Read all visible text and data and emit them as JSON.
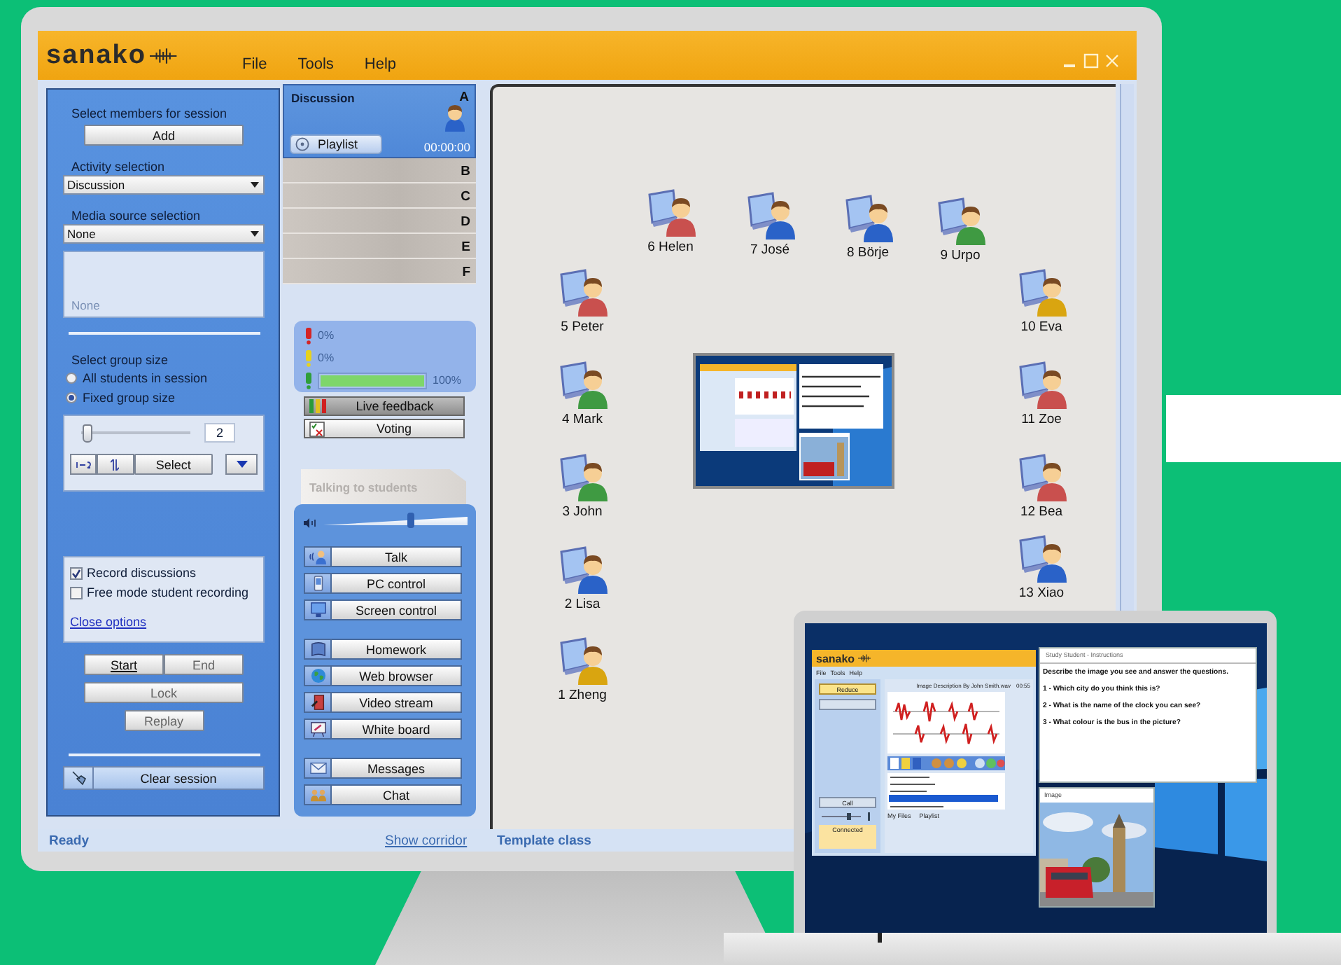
{
  "window": {
    "logo": "sanako",
    "menu": [
      {
        "label": "File"
      },
      {
        "label": "Tools"
      },
      {
        "label": "Help"
      }
    ]
  },
  "members": {
    "label": "Select members for session",
    "button": "Add"
  },
  "activity": {
    "label": "Activity selection",
    "value": "Discussion"
  },
  "media": {
    "label": "Media source selection",
    "value": "None",
    "preview": "None"
  },
  "group_size": {
    "label": "Select group size",
    "options": [
      {
        "label": "All students in session",
        "selected": false
      },
      {
        "label": "Fixed group size",
        "selected": true
      }
    ],
    "slider": {
      "level": 0
    },
    "count": "2",
    "select_button": "Select"
  },
  "options": {
    "checks": [
      {
        "label": "Record discussions",
        "checked": true
      },
      {
        "label": "Free mode student recording",
        "checked": false
      }
    ],
    "link": "Close options"
  },
  "session_buttons": [
    {
      "label": "Start",
      "disabled": false
    },
    {
      "label": "End",
      "disabled": true
    },
    {
      "label": "Lock",
      "disabled": true
    },
    {
      "label": "Replay",
      "disabled": true
    }
  ],
  "clear_button": "Clear session",
  "groups": [
    {
      "letter": "A",
      "selected": true,
      "title": "Discussion",
      "playlist": "Playlist",
      "time": "00:00:00"
    },
    {
      "letter": "B",
      "selected": false
    },
    {
      "letter": "C",
      "selected": false
    },
    {
      "letter": "D",
      "selected": false
    },
    {
      "letter": "E",
      "selected": false
    },
    {
      "letter": "F",
      "selected": false
    }
  ],
  "feedback": {
    "rows": [
      {
        "color": "#d42424",
        "reading": "0%"
      },
      {
        "color": "#e6d21e",
        "reading": "0%"
      },
      {
        "color": "#2f9e3a",
        "level": 1,
        "reading": "100%"
      }
    ],
    "buttons": [
      {
        "label": "Live feedback",
        "kind": "feedback",
        "selected": true
      },
      {
        "label": "Voting",
        "kind": "voting",
        "selected": false
      }
    ]
  },
  "talking": {
    "label": "Talking to students",
    "volume": {
      "level": 0.6
    },
    "button_groups": [
      [
        {
          "label": "Talk",
          "kind": "talk"
        },
        {
          "label": "PC control",
          "kind": "pc"
        },
        {
          "label": "Screen control",
          "kind": "screen"
        }
      ],
      [
        {
          "label": "Homework",
          "kind": "homework"
        },
        {
          "label": "Web browser",
          "kind": "web"
        },
        {
          "label": "Video stream",
          "kind": "video"
        },
        {
          "label": "White board",
          "kind": "whiteboard"
        }
      ],
      [
        {
          "label": "Messages",
          "kind": "messages"
        },
        {
          "label": "Chat",
          "kind": "chat"
        }
      ]
    ]
  },
  "canvas": {
    "students": [
      {
        "name": "6 Helen",
        "color": "#c9504e"
      },
      {
        "name": "7 José",
        "color": "#2a62c8"
      },
      {
        "name": "8 Börje",
        "color": "#2a62c8"
      },
      {
        "name": "9 Urpo",
        "color": "#3f9a42"
      },
      {
        "name": "5 Peter",
        "color": "#c9504e"
      },
      {
        "name": "10 Eva",
        "color": "#d9a510"
      },
      {
        "name": "4 Mark",
        "color": "#3f9a42"
      },
      {
        "name": "11 Zoe",
        "color": "#c9504e"
      },
      {
        "name": "3 John",
        "color": "#3f9a42"
      },
      {
        "name": "12 Bea",
        "color": "#c9504e"
      },
      {
        "name": "2 Lisa",
        "color": "#2a62c8"
      },
      {
        "name": "13 Xiao",
        "color": "#2a62c8"
      },
      {
        "name": "1 Zheng",
        "color": "#d9a510"
      }
    ]
  },
  "status_bar": {
    "status": "Ready",
    "link": "Show corridor",
    "class_name": "Template class"
  },
  "laptop": {
    "app": {
      "logo": "sanako",
      "menu": [
        {
          "label": "File"
        },
        {
          "label": "Tools"
        },
        {
          "label": "Help"
        }
      ],
      "buttons": [
        "Reduce",
        "Call"
      ],
      "track_title": "Image Description By John Smith.wav",
      "track_time": "00:55",
      "status": "Connected",
      "tabs": [
        "My Files",
        "Playlist"
      ]
    },
    "instructions": {
      "title": "Study Student - Instructions",
      "lines": [
        "Describe the image you see and answer the questions.",
        "1 - Which city do you think this is?",
        "2 - What is the name of the clock you can see?",
        "3 - What colour is the bus in the picture?"
      ]
    },
    "image_window": {
      "title": "Image"
    }
  }
}
